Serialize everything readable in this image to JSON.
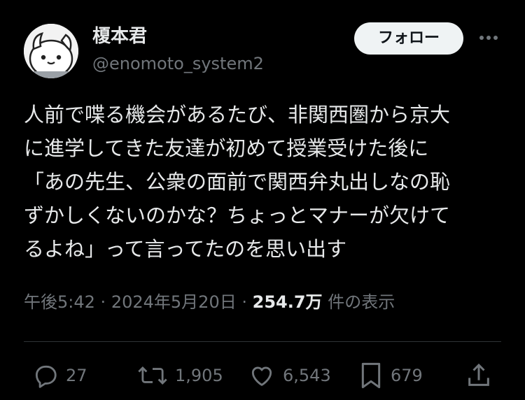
{
  "author": {
    "name": "榎本君",
    "handle": "@enomoto_system2"
  },
  "follow_label": "フォロー",
  "tweet": {
    "text": "人前で喋る機会があるたび、非関西圏から京大\nに進学してきた友達が初めて授業受けた後に\n「あの先生、公衆の面前で関西弁丸出しなの恥\nずかしくないのかな？ちょっとマナーが欠けて\nるよね」って言ってたのを思い出す"
  },
  "meta": {
    "time": "午後5:42",
    "date": "2024年5月20日",
    "separator": "·",
    "views_count": "254.7万",
    "views_label": "件の表示"
  },
  "actions": {
    "replies": "27",
    "reposts": "1,905",
    "likes": "6,543",
    "bookmarks": "679"
  },
  "icons": [
    "avatar",
    "more-icon",
    "reply-icon",
    "repost-icon",
    "like-icon",
    "bookmark-icon",
    "share-icon"
  ]
}
